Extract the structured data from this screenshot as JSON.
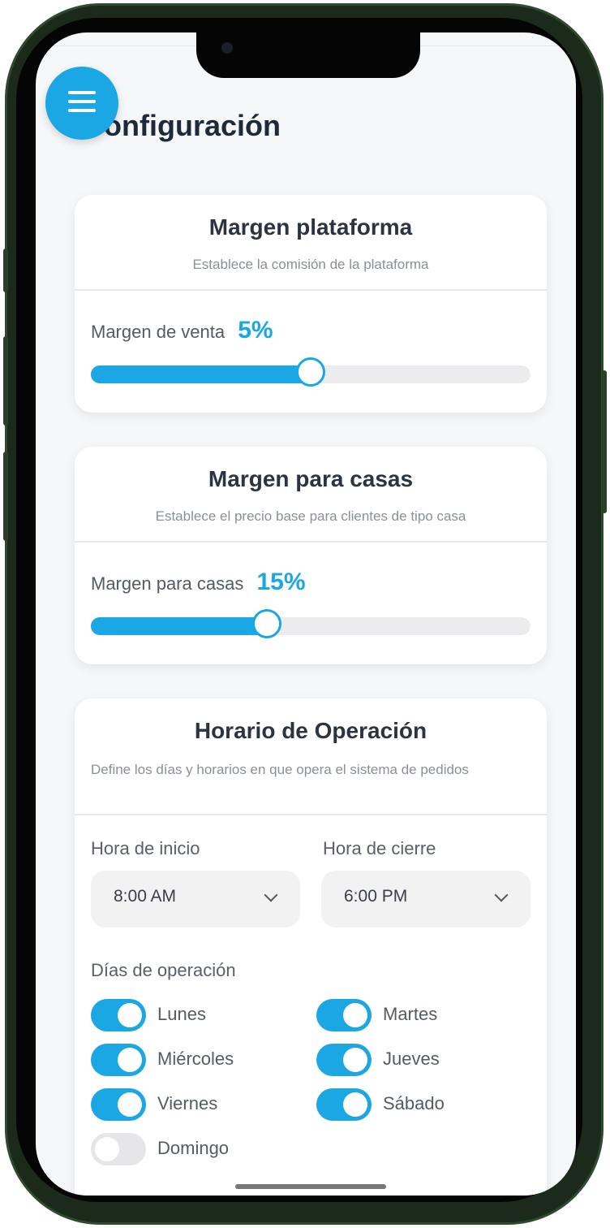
{
  "page": {
    "title": "Configuración"
  },
  "menu": {
    "icon": "hamburger-menu-icon"
  },
  "colors": {
    "accent": "#1aa7e4",
    "track": "#ececee",
    "toggle_off": "#e6e6e8"
  },
  "platform_margin": {
    "title": "Margen plataforma",
    "subtitle": "Establece la comisión de la plataforma",
    "label": "Margen de venta",
    "value_text": "5%",
    "slider_fraction": 0.5
  },
  "house_margin": {
    "title": "Margen para casas",
    "subtitle": "Establece el precio base para clientes de tipo casa",
    "label": "Margen para casas",
    "value_text": "15%",
    "slider_fraction": 0.4
  },
  "schedule": {
    "title": "Horario de Operación",
    "subtitle": "Define los días y horarios en que opera el sistema de pedidos",
    "start_label": "Hora de inicio",
    "start_value": "8:00 AM",
    "end_label": "Hora de cierre",
    "end_value": "6:00 PM",
    "days_label": "Días de operación",
    "days": [
      {
        "name": "Lunes",
        "enabled": true
      },
      {
        "name": "Martes",
        "enabled": true
      },
      {
        "name": "Miércoles",
        "enabled": true
      },
      {
        "name": "Jueves",
        "enabled": true
      },
      {
        "name": "Viernes",
        "enabled": true
      },
      {
        "name": "Sábado",
        "enabled": true
      },
      {
        "name": "Domingo",
        "enabled": false
      }
    ]
  }
}
